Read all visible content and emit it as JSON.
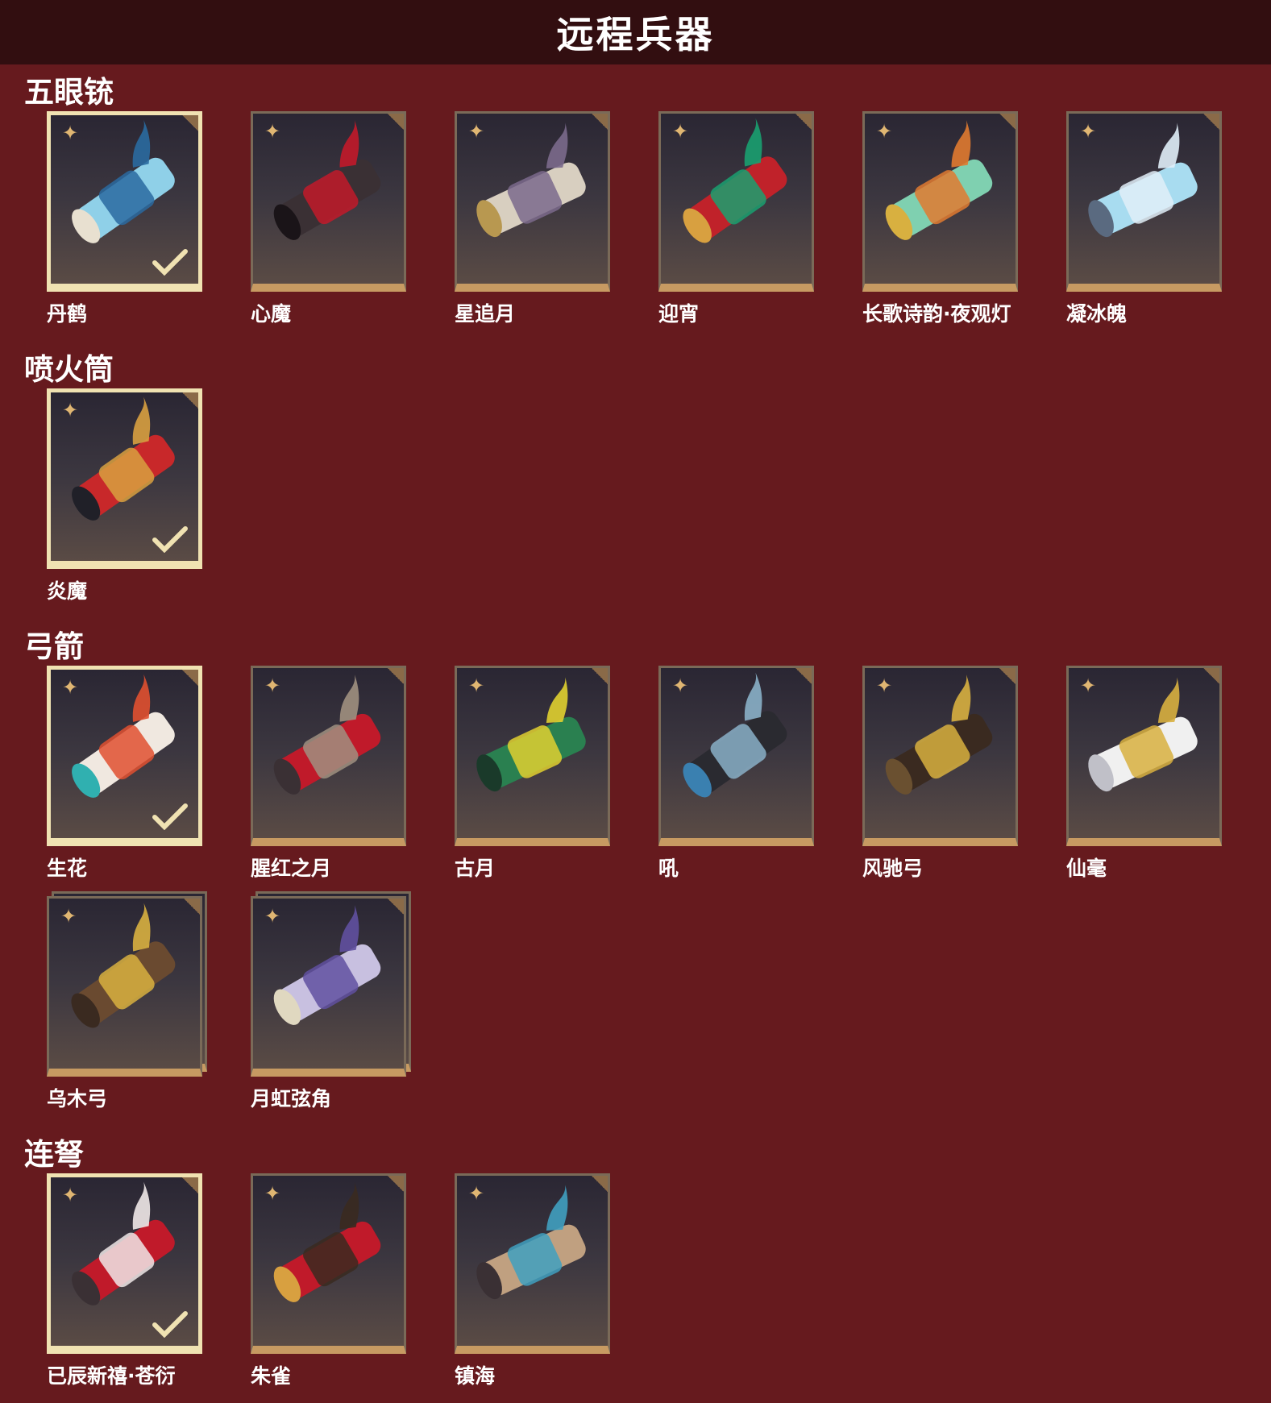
{
  "header": {
    "title": "远程兵器"
  },
  "sections": [
    {
      "title": "五眼铳",
      "items": [
        {
          "name": "丹鹤",
          "selected": true,
          "palette": [
            "#8fd0e8",
            "#2a6aa0",
            "#e8e0d0"
          ]
        },
        {
          "name": "心魔",
          "selected": false,
          "palette": [
            "#3a3034",
            "#c21a2a",
            "#1a1418"
          ]
        },
        {
          "name": "星追月",
          "selected": false,
          "palette": [
            "#d8cfc0",
            "#7b6a8c",
            "#b89850"
          ]
        },
        {
          "name": "迎宵",
          "selected": false,
          "palette": [
            "#c0222a",
            "#1aa070",
            "#d8a040"
          ]
        },
        {
          "name": "长歌诗韵·夜观灯",
          "selected": false,
          "palette": [
            "#7fd0b0",
            "#e07a30",
            "#d8b040"
          ]
        },
        {
          "name": "凝冰魄",
          "selected": false,
          "palette": [
            "#a8dcf0",
            "#e0eef8",
            "#5a6a80"
          ]
        }
      ]
    },
    {
      "title": "喷火筒",
      "items": [
        {
          "name": "炎魔",
          "selected": true,
          "palette": [
            "#c8282a",
            "#d8a040",
            "#202028"
          ]
        }
      ]
    },
    {
      "title": "弓箭",
      "items": [
        {
          "name": "生花",
          "selected": true,
          "palette": [
            "#f0e8e0",
            "#e05030",
            "#30b0b0"
          ]
        },
        {
          "name": "腥红之月",
          "selected": false,
          "palette": [
            "#c01a2a",
            "#a09080",
            "#3a3034"
          ]
        },
        {
          "name": "古月",
          "selected": false,
          "palette": [
            "#2a8050",
            "#e0d030",
            "#1a3a2a"
          ]
        },
        {
          "name": "吼",
          "selected": false,
          "palette": [
            "#2a2a30",
            "#8ab0c8",
            "#3a80b0"
          ]
        },
        {
          "name": "风驰弓",
          "selected": false,
          "palette": [
            "#3a2a20",
            "#d8b040",
            "#6a5030"
          ]
        },
        {
          "name": "仙毫",
          "selected": false,
          "palette": [
            "#f0f0f0",
            "#d8b040",
            "#c0c0c8"
          ]
        },
        {
          "name": "乌木弓",
          "selected": false,
          "stacked": true,
          "palette": [
            "#6a4a30",
            "#d8b040",
            "#3a2a20"
          ]
        },
        {
          "name": "月虹弦角",
          "selected": false,
          "stacked": true,
          "palette": [
            "#c8c0e0",
            "#6050a0",
            "#e0d8c0"
          ]
        }
      ]
    },
    {
      "title": "连弩",
      "items": [
        {
          "name": "已辰新禧·苍衍",
          "selected": true,
          "palette": [
            "#c01a2a",
            "#f0e8e8",
            "#3a3034"
          ]
        },
        {
          "name": "朱雀",
          "selected": false,
          "palette": [
            "#c01a2a",
            "#3a2a20",
            "#d8a040"
          ]
        },
        {
          "name": "镇海",
          "selected": false,
          "palette": [
            "#c0a080",
            "#40a0c0",
            "#3a3034"
          ]
        }
      ]
    }
  ],
  "icons": {
    "rarity": "star-badge-icon",
    "equipped": "checkmark-icon"
  },
  "colors": {
    "background": "#661a1e",
    "header": "#320e10",
    "card_border": "#c79a62",
    "selected_border": "#f0e2b2"
  }
}
